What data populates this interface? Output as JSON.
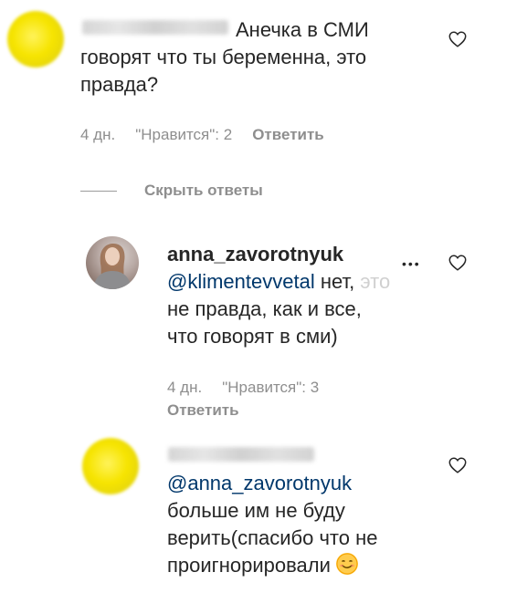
{
  "comment1": {
    "username_hidden": "klimentevvetal",
    "text": "Анечка в СМИ говорят что ты беременна, это правда?",
    "line1": "Анечка в СМИ",
    "line2": "говорят что ты беременна, это",
    "line3": "правда?",
    "time": "4 дн.",
    "likes": "\"Нравится\": 2",
    "reply": "Ответить"
  },
  "hide_replies": "Скрыть ответы",
  "reply1": {
    "username": "anna_zavorotnyuk",
    "mention": "@klimentevvetal",
    "line1_rest": "нет,",
    "line1_faded": "это",
    "line2": "не правда, как и все,",
    "line3": "что говорят в сми)",
    "time": "4 дн.",
    "likes": "\"Нравится\": 3",
    "reply": "Ответить",
    "more": "•••"
  },
  "reply2": {
    "username_hidden": "klimentevvetal",
    "mention": "@anna_zavorotnyuk",
    "line2": "больше им не буду",
    "line3": "верить(спасибо что не",
    "line4": "проигнорировали"
  },
  "icons": {
    "like": "heart-outline-icon",
    "more": "more-dots-icon",
    "emoji": "smiling-face-emoji"
  },
  "colors": {
    "text": "#262626",
    "meta": "#8e8e8e",
    "mention": "#00376b"
  }
}
